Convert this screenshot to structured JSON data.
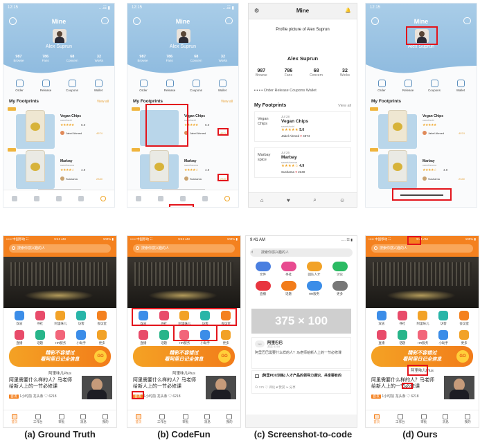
{
  "captions": [
    "(a) Ground Truth",
    "(b) CodeFun",
    "(c) Screenshot-to-code",
    "(d) Ours"
  ],
  "mine": {
    "status_time": "12:15",
    "status_icons": "…☷ ▮",
    "title": "Mine",
    "name": "Alex Suprun",
    "stats": [
      {
        "value": "987",
        "label": "Browse"
      },
      {
        "value": "786",
        "label": "Fans"
      },
      {
        "value": "68",
        "label": "Concern"
      },
      {
        "value": "32",
        "label": "Works"
      }
    ],
    "quick": [
      "Order",
      "Release",
      "Coupons",
      "Wallet"
    ],
    "footprints_title": "My Footprints",
    "view_all": "View all",
    "products": [
      {
        "title": "Vegan Chips",
        "sub": "sweet/acid",
        "stars": "★★★★★",
        "rating": "5.0",
        "user": "Jabel Ahmed",
        "likes": "4974"
      },
      {
        "title": "Marbay",
        "sub": "sweet/aroma",
        "stars": "★★★★☆",
        "rating": "4.9",
        "user": "Sushama",
        "likes": "2340"
      }
    ]
  },
  "plain": {
    "title": "Mine",
    "profile_alt": "Profile picture of Alex Suprun",
    "name": "Alex Suprun",
    "stats": [
      {
        "value": "987",
        "label": "Browse"
      },
      {
        "value": "786",
        "label": "Fans"
      },
      {
        "value": "68",
        "label": "Concern"
      },
      {
        "value": "32",
        "label": "Works"
      }
    ],
    "menu": "Order Release Coupons Wallet",
    "footprints_title": "My Footprints",
    "view_all": "View all",
    "products": [
      {
        "date": "Jul 28",
        "title": "Vegan Chips",
        "sub": "sweet/acid",
        "img_alt": "Vegan Chips",
        "stars": "★★★★★",
        "rating": "5.0",
        "user": "Jabel Ahmed",
        "likes": "4974"
      },
      {
        "date": "Jul 26",
        "title": "Marbay",
        "sub": "sweet/aroma",
        "img_alt": "Marbay spice",
        "stars": "★★★★☆",
        "rating": "4.9",
        "user": "Sushama",
        "likes": "2340"
      }
    ],
    "nav": [
      "⌂",
      "♥",
      "⌕",
      "☺"
    ]
  },
  "cn": {
    "status_left": "••••• 中国移动 ☷",
    "status_time": "9:41 AM",
    "status_right": "100% ▮",
    "search_placeholder": "搜索你感兴趣的人",
    "grid": [
      "双志",
      "寻社",
      "阿里味儿",
      "访客",
      "会议室",
      "直播",
      "话题",
      "HR服务",
      "小助手",
      "更多"
    ],
    "grid_colors": [
      "#3b8de8",
      "#e84b6a",
      "#f2a227",
      "#28b5a8",
      "#f4811f",
      "#e84b6a",
      "#28b58a",
      "#f2657a",
      "#3b8de8",
      "#f2a227"
    ],
    "banner_line1": "精彩不容错过",
    "banner_line2": "看阿里日记全信息",
    "banner_badge": "GO",
    "ali_plus": "阿里味儿Plus",
    "question": "阿里需要什么样的人？马老师给新人上的一节必修课",
    "tag": "首发",
    "meta": "1小时前  龙头条  ♡ 6218",
    "tabs": [
      "首页",
      "工作台",
      "审批",
      "消息",
      "我的"
    ]
  },
  "wire": {
    "time": "9:41 AM",
    "signal": ".… ☷ ▮",
    "search_placeholder": "搜索你感兴趣的人",
    "circles": [
      "文件",
      "寻社",
      "团队人才",
      "讨论",
      "直播",
      "话题",
      "HR服务",
      "更多"
    ],
    "circle_colors": [
      "#4a7fe0",
      "#e84b90",
      "#f2a227",
      "#2bbb63",
      "#e8353f",
      "#f27c1a",
      "#3b8de8",
      "#777777"
    ],
    "placeholder": "375 × 100",
    "card1_logo": "logo",
    "card1_title": "阿里巴巴",
    "card1_sub": "关注 6218",
    "card1_text": "阿里巴巴需要什么样的人？马老师给新人上的一节必修课",
    "card2_title": "[阿里PDX训练] 人才产品的领导力通识、共享要有的",
    "card2_meta": "⊙ 171  ♡ 评论  ♥ 赞赏  ↪ 分享"
  }
}
